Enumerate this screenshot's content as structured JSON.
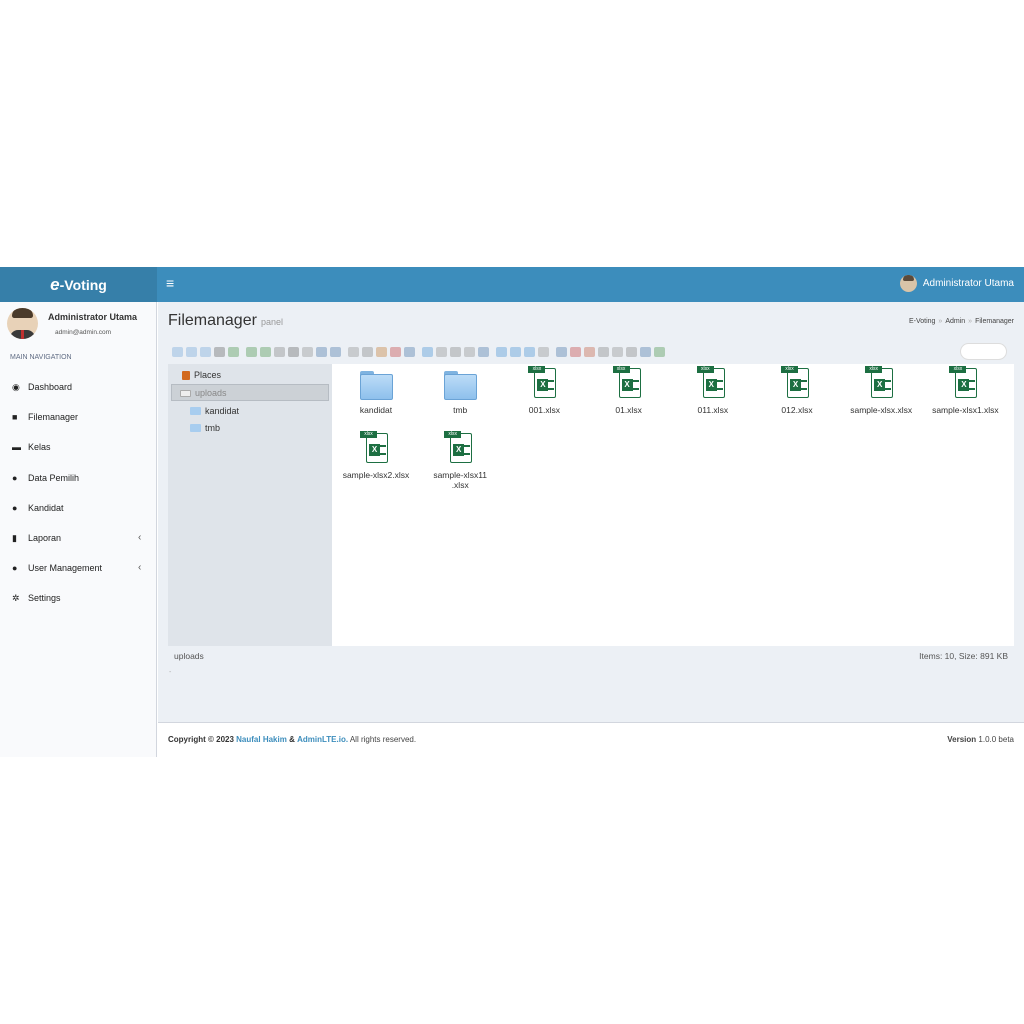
{
  "header": {
    "brand_prefix": "e",
    "brand_rest": "-Voting",
    "menu_icon": "hamburger-icon",
    "user_name": "Administrator Utama"
  },
  "sidebar": {
    "profile": {
      "name": "Administrator Utama",
      "email": "admin@admin.com"
    },
    "section_title": "MAIN NAVIGATION",
    "items": [
      {
        "label": "Dashboard",
        "icon": "dashboard-icon",
        "glyph": "◉"
      },
      {
        "label": "Filemanager",
        "icon": "folder-icon",
        "glyph": "■"
      },
      {
        "label": "Kelas",
        "icon": "monitor-icon",
        "glyph": "▬"
      },
      {
        "label": "Data Pemilih",
        "icon": "user-icon",
        "glyph": "●"
      },
      {
        "label": "Kandidat",
        "icon": "user-secret-icon",
        "glyph": "●"
      },
      {
        "label": "Laporan",
        "icon": "bar-chart-icon",
        "glyph": "▮",
        "chevron": "‹"
      },
      {
        "label": "User Management",
        "icon": "users-icon",
        "glyph": "●",
        "chevron": "‹"
      },
      {
        "label": "Settings",
        "icon": "gear-icon",
        "glyph": "✲"
      }
    ]
  },
  "page": {
    "title": "Filemanager",
    "subtitle": "panel",
    "breadcrumb": [
      "E-Voting",
      "Admin",
      "Filemanager"
    ]
  },
  "filemanager": {
    "tree": {
      "places": "Places",
      "root": "uploads",
      "children": [
        "kandidat",
        "tmb"
      ]
    },
    "files": [
      {
        "name": "kandidat",
        "type": "folder"
      },
      {
        "name": "tmb",
        "type": "folder"
      },
      {
        "name": "001.xlsx",
        "type": "xlsx"
      },
      {
        "name": "01.xlsx",
        "type": "xlsx"
      },
      {
        "name": "011.xlsx",
        "type": "xlsx"
      },
      {
        "name": "012.xlsx",
        "type": "xlsx"
      },
      {
        "name": "sample-xlsx.xlsx",
        "type": "xlsx"
      },
      {
        "name": "sample-xlsx1.xlsx",
        "type": "xlsx"
      },
      {
        "name": "sample-xlsx2.xlsx",
        "type": "xlsx"
      },
      {
        "name": "sample-xlsx11.xlsx",
        "name_line1": "sample-xlsx11",
        "name_line2": ".xlsx",
        "type": "xlsx"
      }
    ],
    "file_tag": "xlsx",
    "file_glyph": "X",
    "status_path": "uploads",
    "status_info": "Items: 10, Size: 891 KB"
  },
  "footer": {
    "copyright": "Copyright © 2023",
    "author": "Naufal Hakim",
    "amp": "&",
    "adminlte": "AdminLTE.io.",
    "rights": "All rights reserved.",
    "version_label": "Version",
    "version": "1.0.0 beta"
  }
}
